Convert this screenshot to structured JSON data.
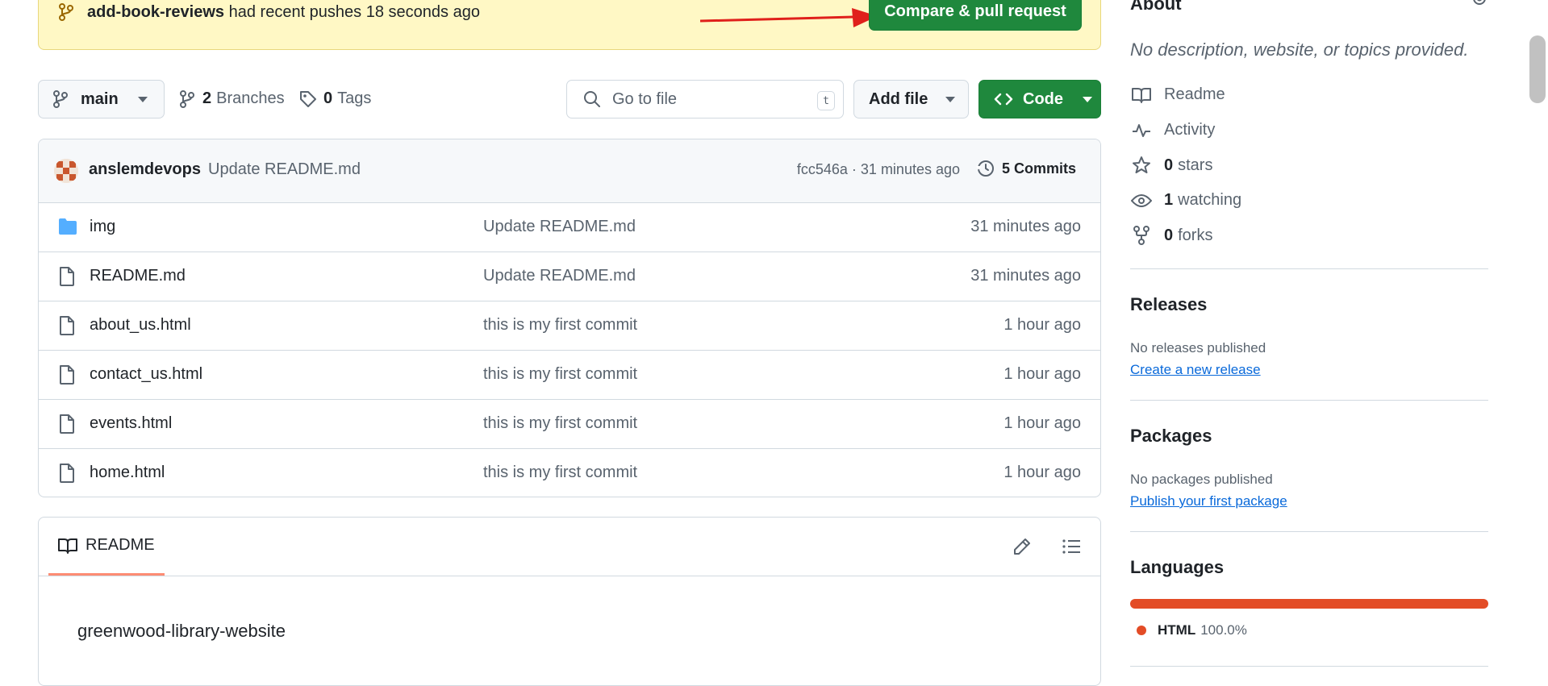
{
  "banner": {
    "branch": "add-book-reviews",
    "message": "had recent pushes 18 seconds ago",
    "compare_label": "Compare & pull request"
  },
  "toolbar": {
    "branch": "main",
    "branches_count": "2",
    "branches_label": "Branches",
    "tags_count": "0",
    "tags_label": "Tags",
    "search_placeholder": "Go to file",
    "search_shortcut": "t",
    "add_file_label": "Add file",
    "code_label": "Code"
  },
  "commit": {
    "author": "anslemdevops",
    "message": "Update README.md",
    "sha_time": "fcc546a · 31 minutes ago",
    "commits_label": "5 Commits"
  },
  "files": [
    {
      "name": "img",
      "type": "folder",
      "message": "Update README.md",
      "time": "31 minutes ago"
    },
    {
      "name": "README.md",
      "type": "file",
      "message": "Update README.md",
      "time": "31 minutes ago"
    },
    {
      "name": "about_us.html",
      "type": "file",
      "message": "this is my first commit",
      "time": "1 hour ago"
    },
    {
      "name": "contact_us.html",
      "type": "file",
      "message": "this is my first commit",
      "time": "1 hour ago"
    },
    {
      "name": "events.html",
      "type": "file",
      "message": "this is my first commit",
      "time": "1 hour ago"
    },
    {
      "name": "home.html",
      "type": "file",
      "message": "this is my first commit",
      "time": "1 hour ago"
    }
  ],
  "readme": {
    "tab_label": "README",
    "title": "greenwood-library-website"
  },
  "sidebar": {
    "about_heading": "About",
    "description": "No description, website, or topics provided.",
    "readme": "Readme",
    "activity": "Activity",
    "stars_count": "0",
    "stars_label": "stars",
    "watching_count": "1",
    "watching_label": "watching",
    "forks_count": "0",
    "forks_label": "forks",
    "releases_heading": "Releases",
    "releases_text": "No releases published",
    "releases_link": "Create a new release",
    "packages_heading": "Packages",
    "packages_text": "No packages published",
    "packages_link": "Publish your first package",
    "languages_heading": "Languages",
    "language_name": "HTML",
    "language_percent": "100.0%",
    "language_color": "#e34c26"
  },
  "colors": {
    "accent_green": "#1f883d",
    "banner_bg": "#fff8c5",
    "link": "#0969da",
    "folder": "#54aeff",
    "arrow": "#e0201b"
  }
}
